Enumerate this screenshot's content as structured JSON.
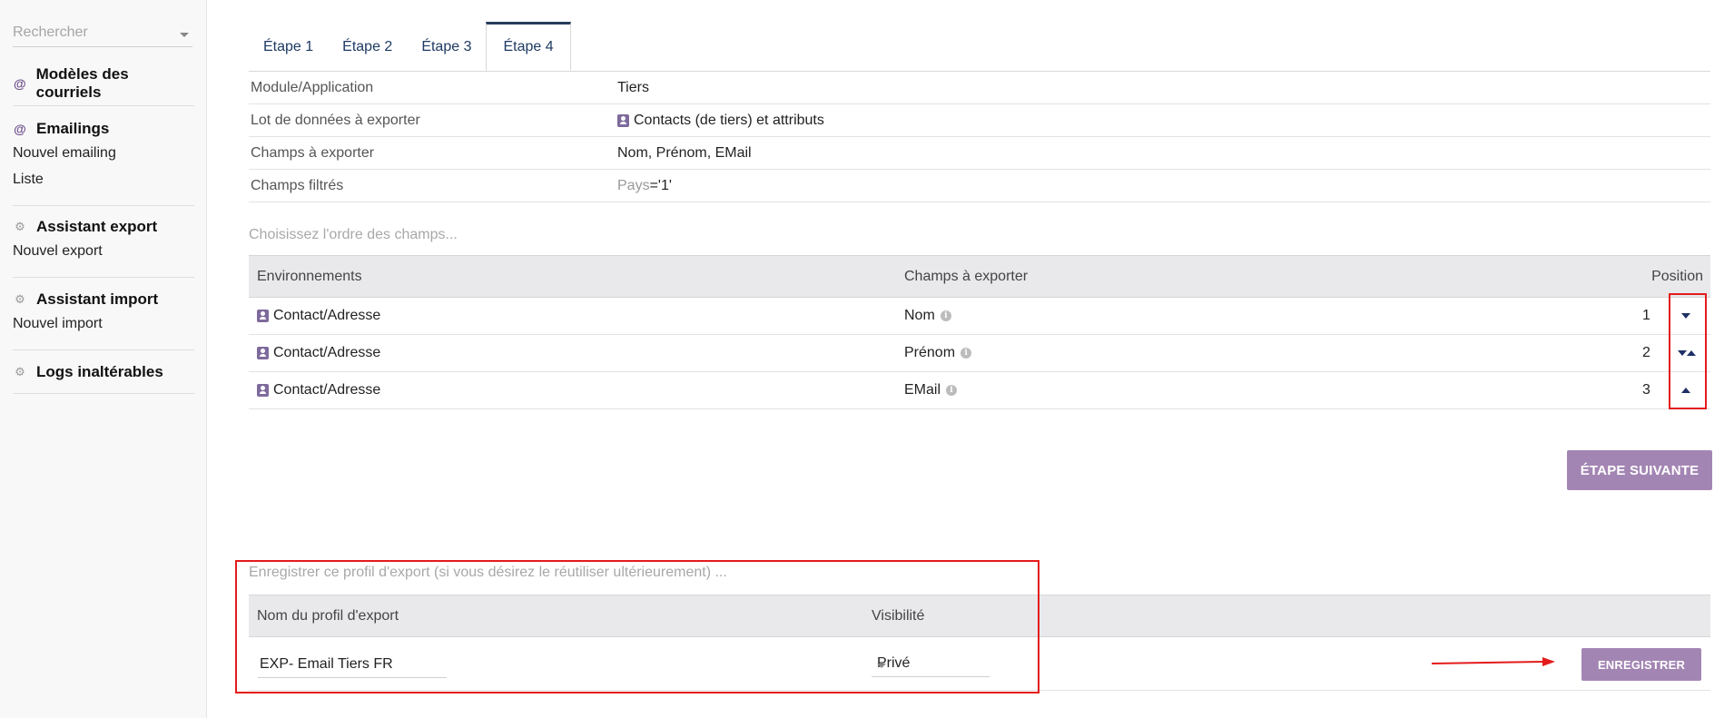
{
  "sidebar": {
    "search_placeholder": "Rechercher",
    "sections": [
      {
        "title": "Modèles des courriels",
        "icon": "at-icon",
        "items": []
      },
      {
        "title": "Emailings",
        "icon": "at-icon",
        "items": [
          "Nouvel emailing",
          "Liste"
        ]
      },
      {
        "title": "Assistant export",
        "icon": "gears-icon",
        "items": [
          "Nouvel export"
        ]
      },
      {
        "title": "Assistant import",
        "icon": "gears-icon",
        "items": [
          "Nouvel import"
        ]
      },
      {
        "title": "Logs inaltérables",
        "icon": "gears-icon",
        "items": []
      }
    ]
  },
  "tabs": [
    "Étape 1",
    "Étape 2",
    "Étape 3",
    "Étape 4"
  ],
  "active_tab": "Étape 4",
  "info": {
    "module_label": "Module/Application",
    "module_value": "Tiers",
    "lot_label": "Lot de données à exporter",
    "lot_value": "Contacts (de tiers) et attributs",
    "champs_label": "Champs à exporter",
    "champs_value": "Nom, Prénom, EMail",
    "filtres_label": "Champs filtrés",
    "filtres_field": "Pays",
    "filtres_value": "='1'"
  },
  "order": {
    "hint": "Choisissez l'ordre des champs...",
    "headers": {
      "env": "Environnements",
      "champ": "Champs à exporter",
      "position": "Position"
    },
    "rows": [
      {
        "env": "Contact/Adresse",
        "champ": "Nom",
        "position": "1"
      },
      {
        "env": "Contact/Adresse",
        "champ": "Prénom",
        "position": "2"
      },
      {
        "env": "Contact/Adresse",
        "champ": "EMail",
        "position": "3"
      }
    ]
  },
  "next_button": "ÉTAPE SUIVANTE",
  "profile": {
    "hint": "Enregistrer ce profil d'export (si vous désirez le réutiliser ultérieurement) ...",
    "headers": {
      "name": "Nom du profil d'export",
      "visibility": "Visibilité"
    },
    "name_value": "EXP- Email Tiers FR",
    "visibility_value": "Privé",
    "save_button": "ENREGISTRER"
  },
  "colors": {
    "accent_purple": "#a385b3",
    "tab_text": "#1f3a63",
    "annotation_red": "#e31b1b"
  }
}
